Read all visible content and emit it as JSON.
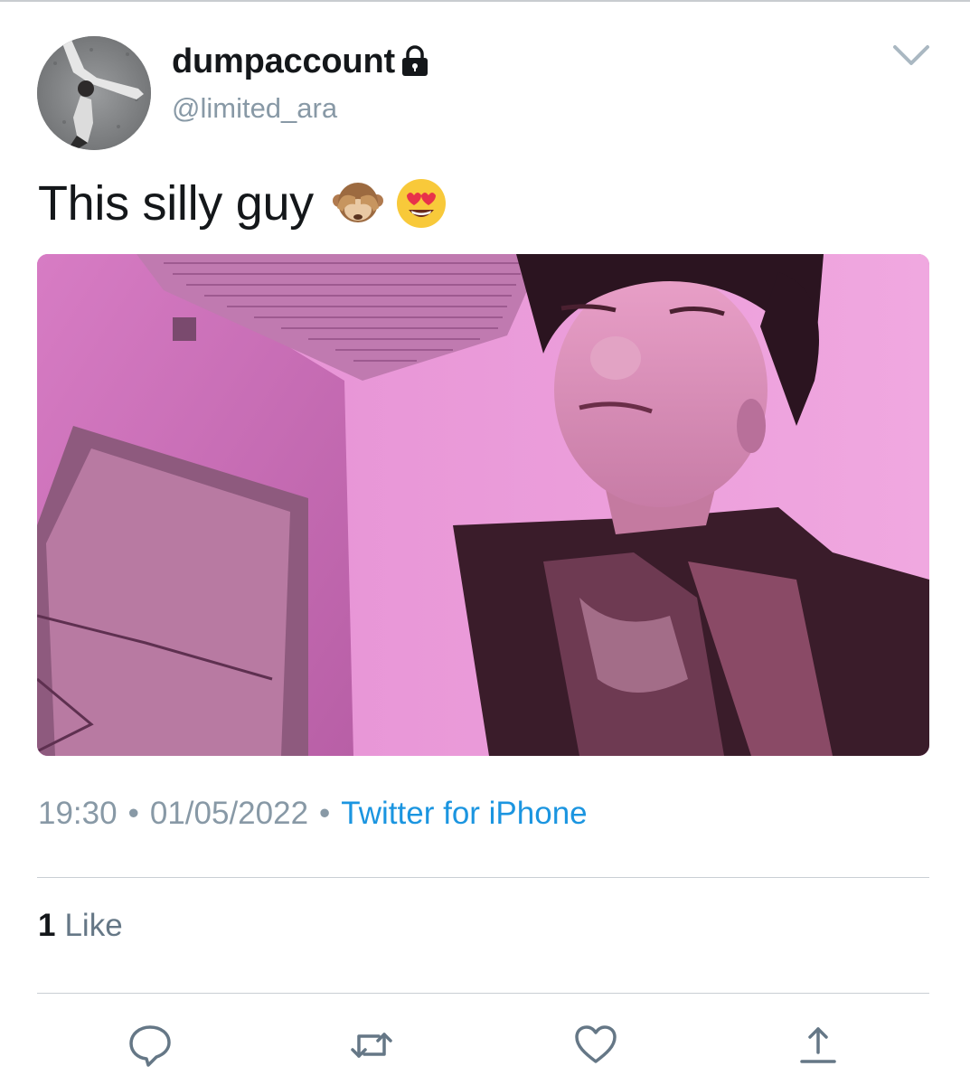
{
  "tweet": {
    "display_name": "dumpaccount",
    "handle": "@limited_ara",
    "text": "This silly guy",
    "emojis": [
      "see-no-evil-monkey",
      "heart-eyes-face"
    ],
    "time": "19:30",
    "date": "01/05/2022",
    "separator": "•",
    "source": "Twitter for iPhone",
    "likes_count": "1",
    "likes_label": "Like"
  },
  "icons": {
    "lock": "lock-icon",
    "caret": "chevron-down-icon",
    "reply": "reply-icon",
    "retweet": "retweet-icon",
    "like": "heart-icon",
    "share": "share-icon"
  },
  "colors": {
    "text": "#14171a",
    "secondary": "#8899a6",
    "link": "#1b95e0",
    "divider": "#c9cfd4",
    "media_tint": "#c46cab"
  }
}
